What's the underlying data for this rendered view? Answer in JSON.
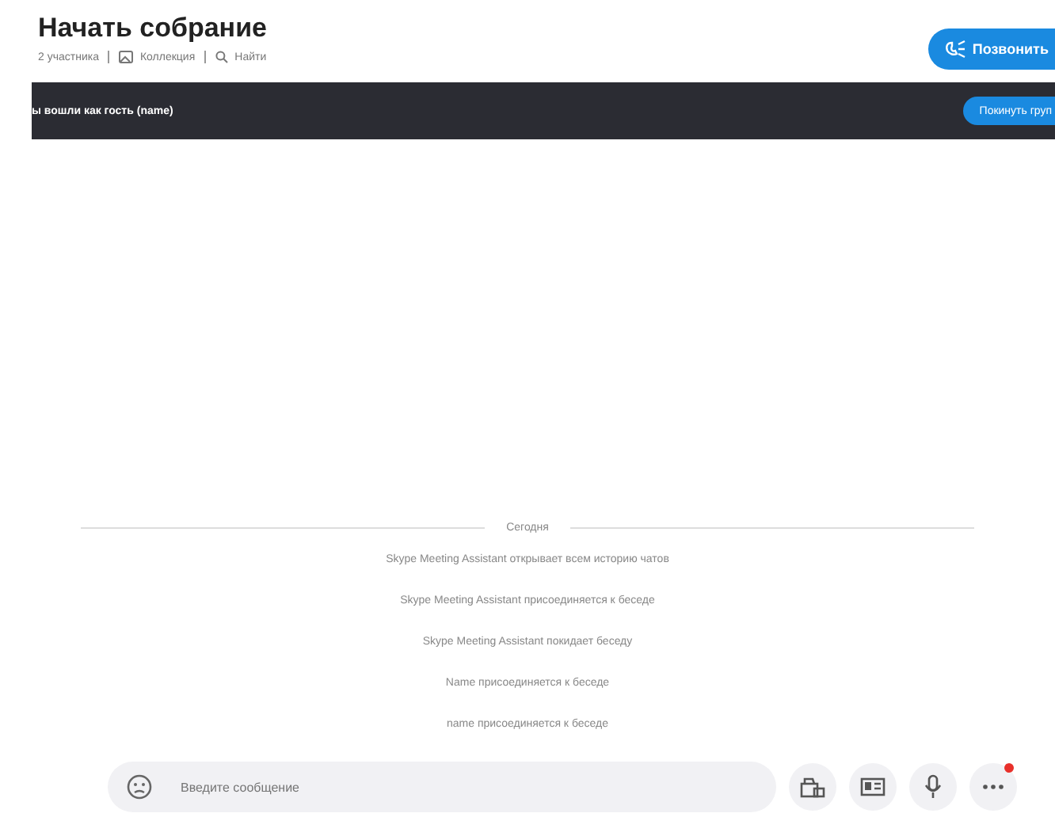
{
  "header": {
    "title": "Начать собрание",
    "participants": "2 участника",
    "collection": "Коллекция",
    "find": "Найти",
    "call_button": "Позвонить"
  },
  "guest_bar": {
    "text": "ы вошли как гость (name)",
    "leave_button": "Покинуть груп"
  },
  "chat": {
    "date_divider": "Сегодня",
    "events": [
      {
        "text": "Skype Meeting Assistant открывает всем историю чатов"
      },
      {
        "text": "Skype Meeting Assistant присоединяется к беседе"
      },
      {
        "text": "Skype Meeting Assistant покидает беседу"
      },
      {
        "text": "Name присоединяется к беседе"
      },
      {
        "text": "name присоединяется к беседе"
      }
    ]
  },
  "composer": {
    "placeholder": "Введите сообщение",
    "more_notification": true
  }
}
